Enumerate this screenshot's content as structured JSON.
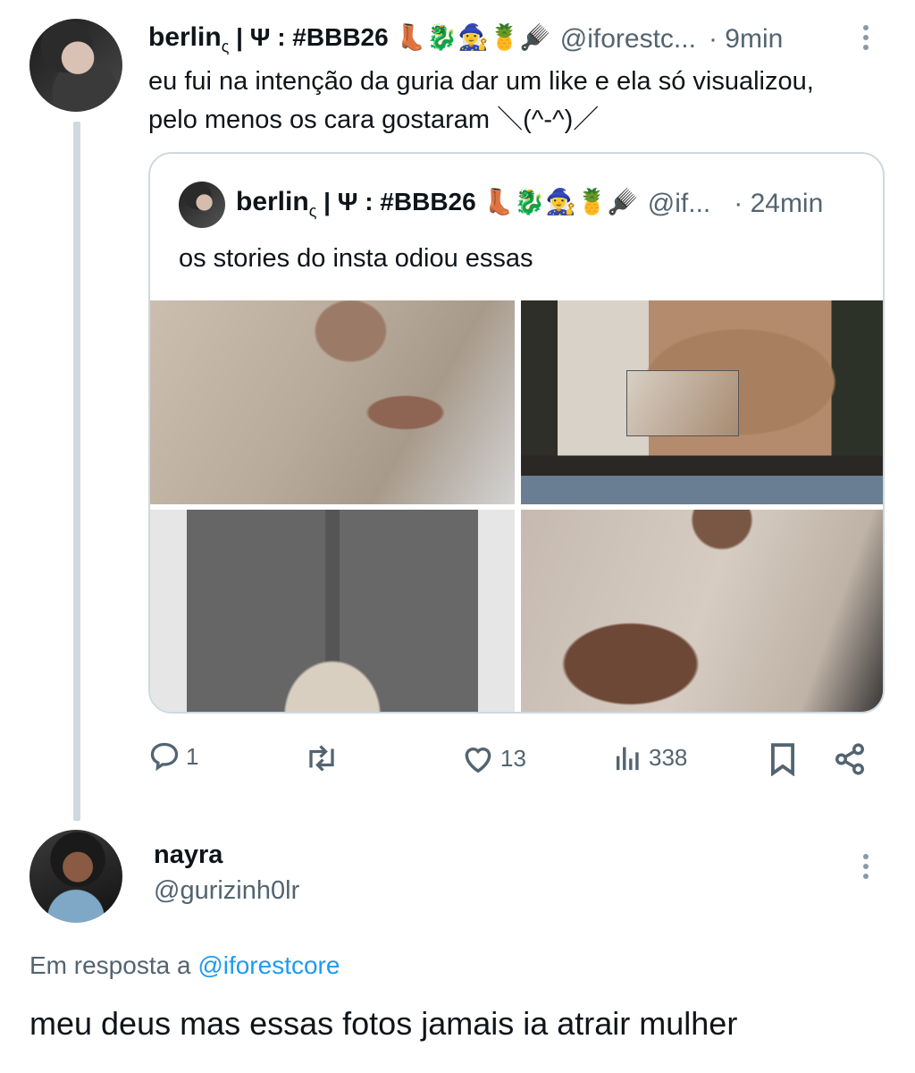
{
  "main_tweet": {
    "name": "berlin",
    "name_sub": "ς",
    "name_suffix": " | Ψ : #BBB26 👢🐉🧙‍♀️🍍🪮",
    "handle": "@iforestc...",
    "time": "· 9min",
    "text_line1": "eu fui na intenção da guria dar um like e ela só visualizou,",
    "text_line2": "pelo menos os cara gostaram ＼(^-^)／"
  },
  "quoted_tweet": {
    "name": "berlin",
    "name_sub": "ς",
    "name_suffix": " | Ψ : #BBB26 👢🐉🧙‍♀️🍍🪮",
    "handle": "@if...",
    "time": "· 24min",
    "text": "os stories do insta odiou essas"
  },
  "actions": {
    "replies": "1",
    "retweets": "",
    "likes": "13",
    "views": "338"
  },
  "reply_tweet": {
    "name": "nayra",
    "handle": "@gurizinh0lr",
    "in_reply_label": "Em resposta a",
    "in_reply_handle": "@iforestcore",
    "text": "meu deus mas essas fotos jamais ia atrair mulher"
  },
  "icons": [
    "more-icon",
    "reply-icon",
    "retweet-icon",
    "like-icon",
    "views-icon",
    "bookmark-icon",
    "share-icon"
  ],
  "colors": {
    "link": "#1d9bf0",
    "muted": "#536471",
    "text": "#0f1419",
    "border": "#cfd9de"
  }
}
